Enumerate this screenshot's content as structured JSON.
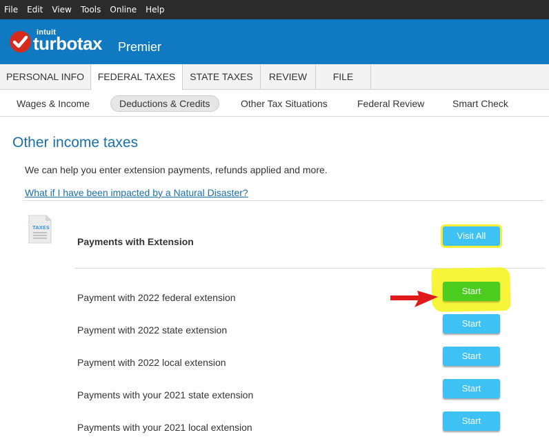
{
  "menu": [
    "File",
    "Edit",
    "View",
    "Tools",
    "Online",
    "Help"
  ],
  "brand": {
    "intuit": "intuit",
    "product": "turbotax",
    "edition": "Premier"
  },
  "nav_tabs": [
    {
      "label": "PERSONAL INFO"
    },
    {
      "label": "FEDERAL TAXES"
    },
    {
      "label": "STATE TAXES"
    },
    {
      "label": "REVIEW"
    },
    {
      "label": "FILE"
    }
  ],
  "nav_active": "FEDERAL TAXES",
  "sub_nav": [
    {
      "label": "Wages & Income"
    },
    {
      "label": "Deductions & Credits"
    },
    {
      "label": "Other Tax Situations"
    },
    {
      "label": "Federal Review"
    },
    {
      "label": "Smart Check"
    }
  ],
  "sub_nav_active": "Deductions & Credits",
  "page": {
    "title": "Other income taxes",
    "intro": "We can help you enter extension payments, refunds applied and more.",
    "disaster_link": "What if I have been impacted by a Natural Disaster?",
    "icon_label": "TAXES",
    "section_title": "Payments with Extension",
    "visit_all_label": "Visit All"
  },
  "rows": [
    {
      "label": "Payment with 2022 federal extension",
      "button": "Start"
    },
    {
      "label": "Payment with 2022 state extension",
      "button": "Start"
    },
    {
      "label": "Payment with 2022 local extension",
      "button": "Start"
    },
    {
      "label": "Payments with your 2021 state extension",
      "button": "Start"
    },
    {
      "label": "Payments with your 2021 local extension",
      "button": "Start"
    }
  ],
  "colors": {
    "menubar": "#2b2b2b",
    "brand_blue": "#0f7ac2",
    "button_blue": "#3ec1f3",
    "button_green": "#4bcc1e",
    "highlight_yellow": "#f6f53a",
    "arrow_red": "#e0191b",
    "title_blue": "#1a6fa8"
  }
}
